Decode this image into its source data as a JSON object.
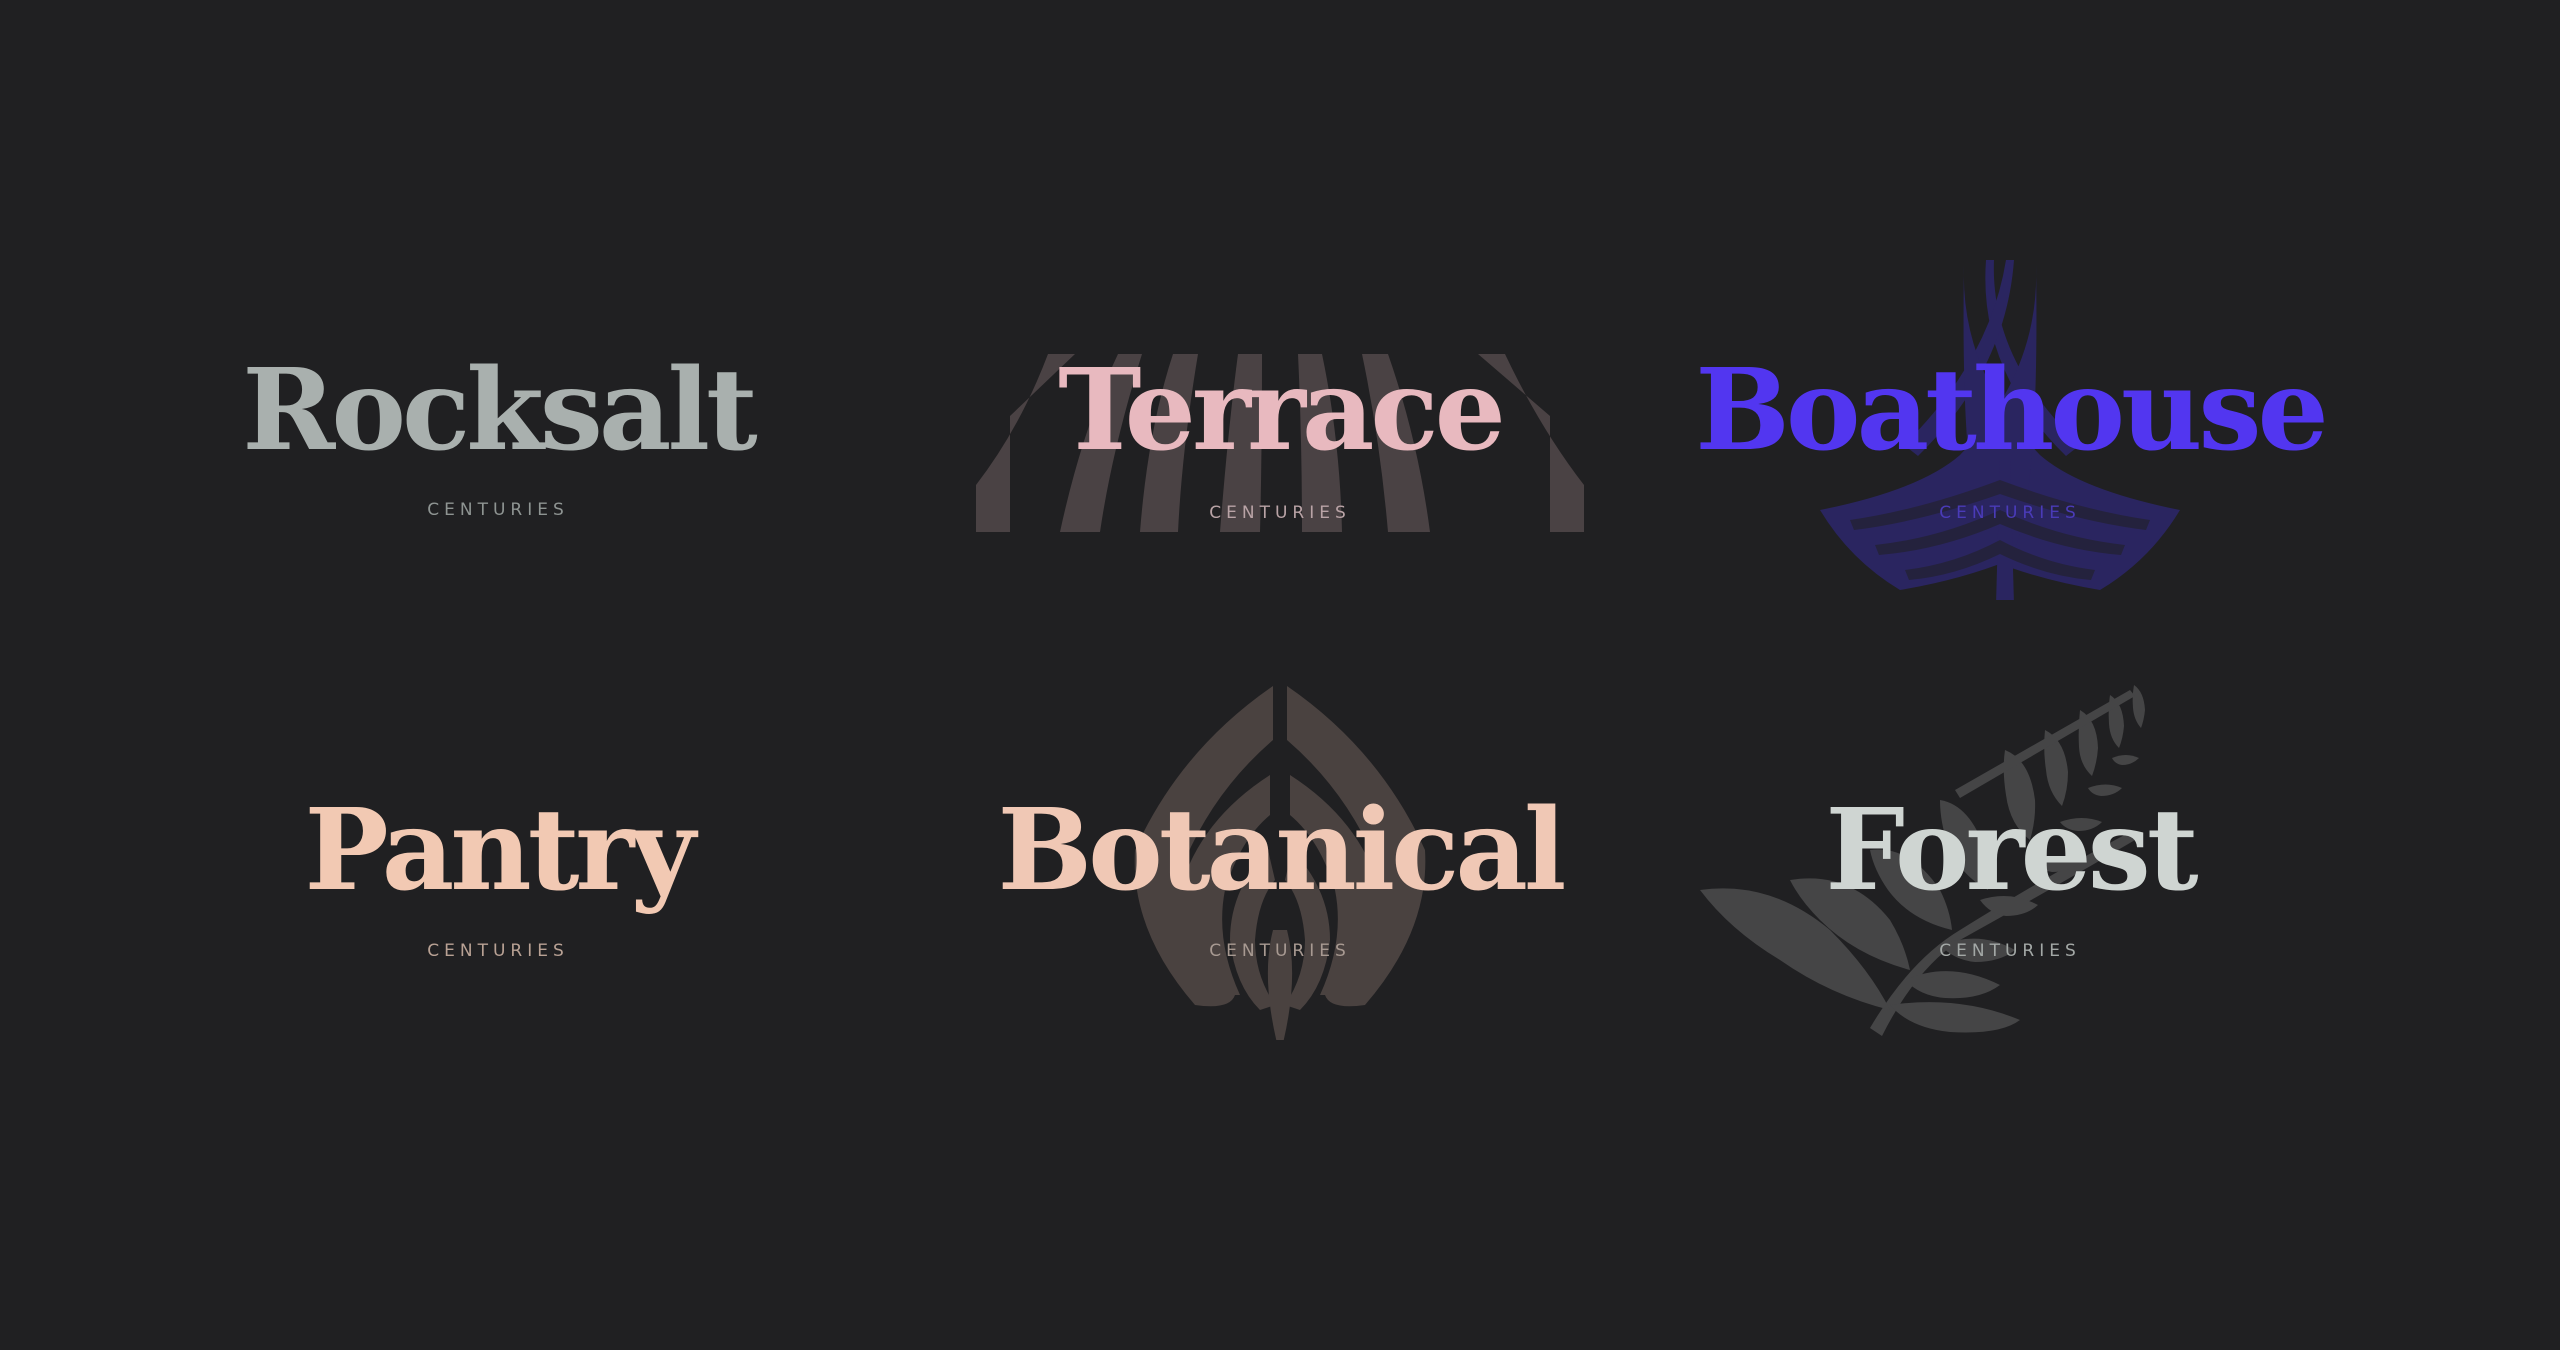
{
  "colors": {
    "background": "#202022",
    "rocksalt": "#a9b0ae",
    "terrace": "#e8b9bf",
    "terrace_art": "#4a4244",
    "boathouse": "#5236f0",
    "boathouse_art": "#2a2560",
    "pantry": "#f2c9b3",
    "botanical": "#f0c8b5",
    "botanical_art": "#4a4240",
    "forest": "#cfd5d2",
    "forest_art": "#454546"
  },
  "logos": {
    "rocksalt": {
      "name": "Rocksalt",
      "tagline": "CENTURIES"
    },
    "terrace": {
      "name": "Terrace",
      "tagline": "CENTURIES",
      "art": "awning-stripes-icon"
    },
    "boathouse": {
      "name": "Boathouse",
      "tagline": "CENTURIES",
      "art": "boat-hull-icon"
    },
    "pantry": {
      "name": "Pantry",
      "tagline": "CENTURIES"
    },
    "botanical": {
      "name": "Botanical",
      "tagline": "CENTURIES",
      "art": "leaf-bulb-icon"
    },
    "forest": {
      "name": "Forest",
      "tagline": "CENTURIES",
      "art": "fern-icon"
    }
  }
}
